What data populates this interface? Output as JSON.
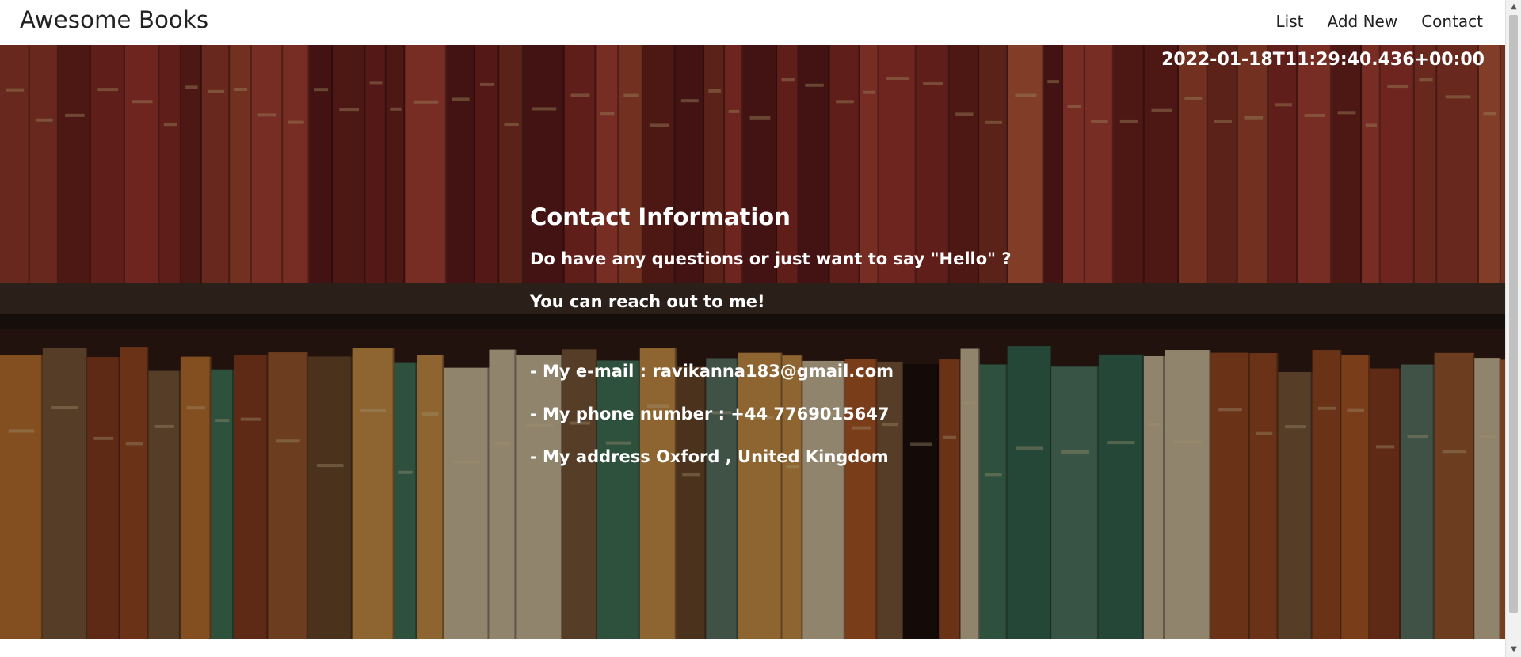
{
  "header": {
    "brand": "Awesome Books",
    "nav": [
      {
        "label": "List"
      },
      {
        "label": "Add New"
      },
      {
        "label": "Contact"
      }
    ]
  },
  "timestamp": "2022-01-18T11:29:40.436+00:00",
  "contact": {
    "title": "Contact Information",
    "intro": "Do have any questions or just want to say \"Hello\" ?",
    "reach": "You can reach out to me!",
    "email": "- My e-mail : ravikanna183@gmail.com",
    "phone": "- My phone number : +44 7769015647",
    "address": "- My address Oxford , United Kingdom"
  },
  "colors": {
    "overlay_text": "#ffffff",
    "navbar_bg": "#ffffff",
    "brand_text": "#222222"
  },
  "icons": {
    "scroll_up": "▲",
    "scroll_down": "▼"
  }
}
